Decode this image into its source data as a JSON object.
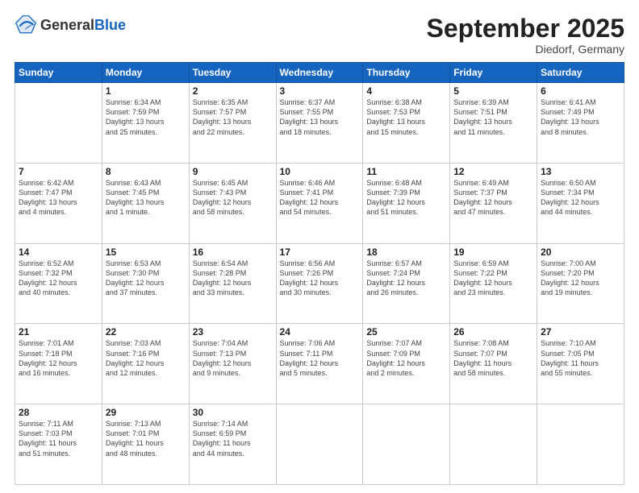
{
  "header": {
    "logo_general": "General",
    "logo_blue": "Blue",
    "title": "September 2025",
    "location": "Diedorf, Germany"
  },
  "days_of_week": [
    "Sunday",
    "Monday",
    "Tuesday",
    "Wednesday",
    "Thursday",
    "Friday",
    "Saturday"
  ],
  "weeks": [
    [
      {
        "day": "",
        "info": ""
      },
      {
        "day": "1",
        "info": "Sunrise: 6:34 AM\nSunset: 7:59 PM\nDaylight: 13 hours\nand 25 minutes."
      },
      {
        "day": "2",
        "info": "Sunrise: 6:35 AM\nSunset: 7:57 PM\nDaylight: 13 hours\nand 22 minutes."
      },
      {
        "day": "3",
        "info": "Sunrise: 6:37 AM\nSunset: 7:55 PM\nDaylight: 13 hours\nand 18 minutes."
      },
      {
        "day": "4",
        "info": "Sunrise: 6:38 AM\nSunset: 7:53 PM\nDaylight: 13 hours\nand 15 minutes."
      },
      {
        "day": "5",
        "info": "Sunrise: 6:39 AM\nSunset: 7:51 PM\nDaylight: 13 hours\nand 11 minutes."
      },
      {
        "day": "6",
        "info": "Sunrise: 6:41 AM\nSunset: 7:49 PM\nDaylight: 13 hours\nand 8 minutes."
      }
    ],
    [
      {
        "day": "7",
        "info": "Sunrise: 6:42 AM\nSunset: 7:47 PM\nDaylight: 13 hours\nand 4 minutes."
      },
      {
        "day": "8",
        "info": "Sunrise: 6:43 AM\nSunset: 7:45 PM\nDaylight: 13 hours\nand 1 minute."
      },
      {
        "day": "9",
        "info": "Sunrise: 6:45 AM\nSunset: 7:43 PM\nDaylight: 12 hours\nand 58 minutes."
      },
      {
        "day": "10",
        "info": "Sunrise: 6:46 AM\nSunset: 7:41 PM\nDaylight: 12 hours\nand 54 minutes."
      },
      {
        "day": "11",
        "info": "Sunrise: 6:48 AM\nSunset: 7:39 PM\nDaylight: 12 hours\nand 51 minutes."
      },
      {
        "day": "12",
        "info": "Sunrise: 6:49 AM\nSunset: 7:37 PM\nDaylight: 12 hours\nand 47 minutes."
      },
      {
        "day": "13",
        "info": "Sunrise: 6:50 AM\nSunset: 7:34 PM\nDaylight: 12 hours\nand 44 minutes."
      }
    ],
    [
      {
        "day": "14",
        "info": "Sunrise: 6:52 AM\nSunset: 7:32 PM\nDaylight: 12 hours\nand 40 minutes."
      },
      {
        "day": "15",
        "info": "Sunrise: 6:53 AM\nSunset: 7:30 PM\nDaylight: 12 hours\nand 37 minutes."
      },
      {
        "day": "16",
        "info": "Sunrise: 6:54 AM\nSunset: 7:28 PM\nDaylight: 12 hours\nand 33 minutes."
      },
      {
        "day": "17",
        "info": "Sunrise: 6:56 AM\nSunset: 7:26 PM\nDaylight: 12 hours\nand 30 minutes."
      },
      {
        "day": "18",
        "info": "Sunrise: 6:57 AM\nSunset: 7:24 PM\nDaylight: 12 hours\nand 26 minutes."
      },
      {
        "day": "19",
        "info": "Sunrise: 6:59 AM\nSunset: 7:22 PM\nDaylight: 12 hours\nand 23 minutes."
      },
      {
        "day": "20",
        "info": "Sunrise: 7:00 AM\nSunset: 7:20 PM\nDaylight: 12 hours\nand 19 minutes."
      }
    ],
    [
      {
        "day": "21",
        "info": "Sunrise: 7:01 AM\nSunset: 7:18 PM\nDaylight: 12 hours\nand 16 minutes."
      },
      {
        "day": "22",
        "info": "Sunrise: 7:03 AM\nSunset: 7:16 PM\nDaylight: 12 hours\nand 12 minutes."
      },
      {
        "day": "23",
        "info": "Sunrise: 7:04 AM\nSunset: 7:13 PM\nDaylight: 12 hours\nand 9 minutes."
      },
      {
        "day": "24",
        "info": "Sunrise: 7:06 AM\nSunset: 7:11 PM\nDaylight: 12 hours\nand 5 minutes."
      },
      {
        "day": "25",
        "info": "Sunrise: 7:07 AM\nSunset: 7:09 PM\nDaylight: 12 hours\nand 2 minutes."
      },
      {
        "day": "26",
        "info": "Sunrise: 7:08 AM\nSunset: 7:07 PM\nDaylight: 11 hours\nand 58 minutes."
      },
      {
        "day": "27",
        "info": "Sunrise: 7:10 AM\nSunset: 7:05 PM\nDaylight: 11 hours\nand 55 minutes."
      }
    ],
    [
      {
        "day": "28",
        "info": "Sunrise: 7:11 AM\nSunset: 7:03 PM\nDaylight: 11 hours\nand 51 minutes."
      },
      {
        "day": "29",
        "info": "Sunrise: 7:13 AM\nSunset: 7:01 PM\nDaylight: 11 hours\nand 48 minutes."
      },
      {
        "day": "30",
        "info": "Sunrise: 7:14 AM\nSunset: 6:59 PM\nDaylight: 11 hours\nand 44 minutes."
      },
      {
        "day": "",
        "info": ""
      },
      {
        "day": "",
        "info": ""
      },
      {
        "day": "",
        "info": ""
      },
      {
        "day": "",
        "info": ""
      }
    ]
  ]
}
